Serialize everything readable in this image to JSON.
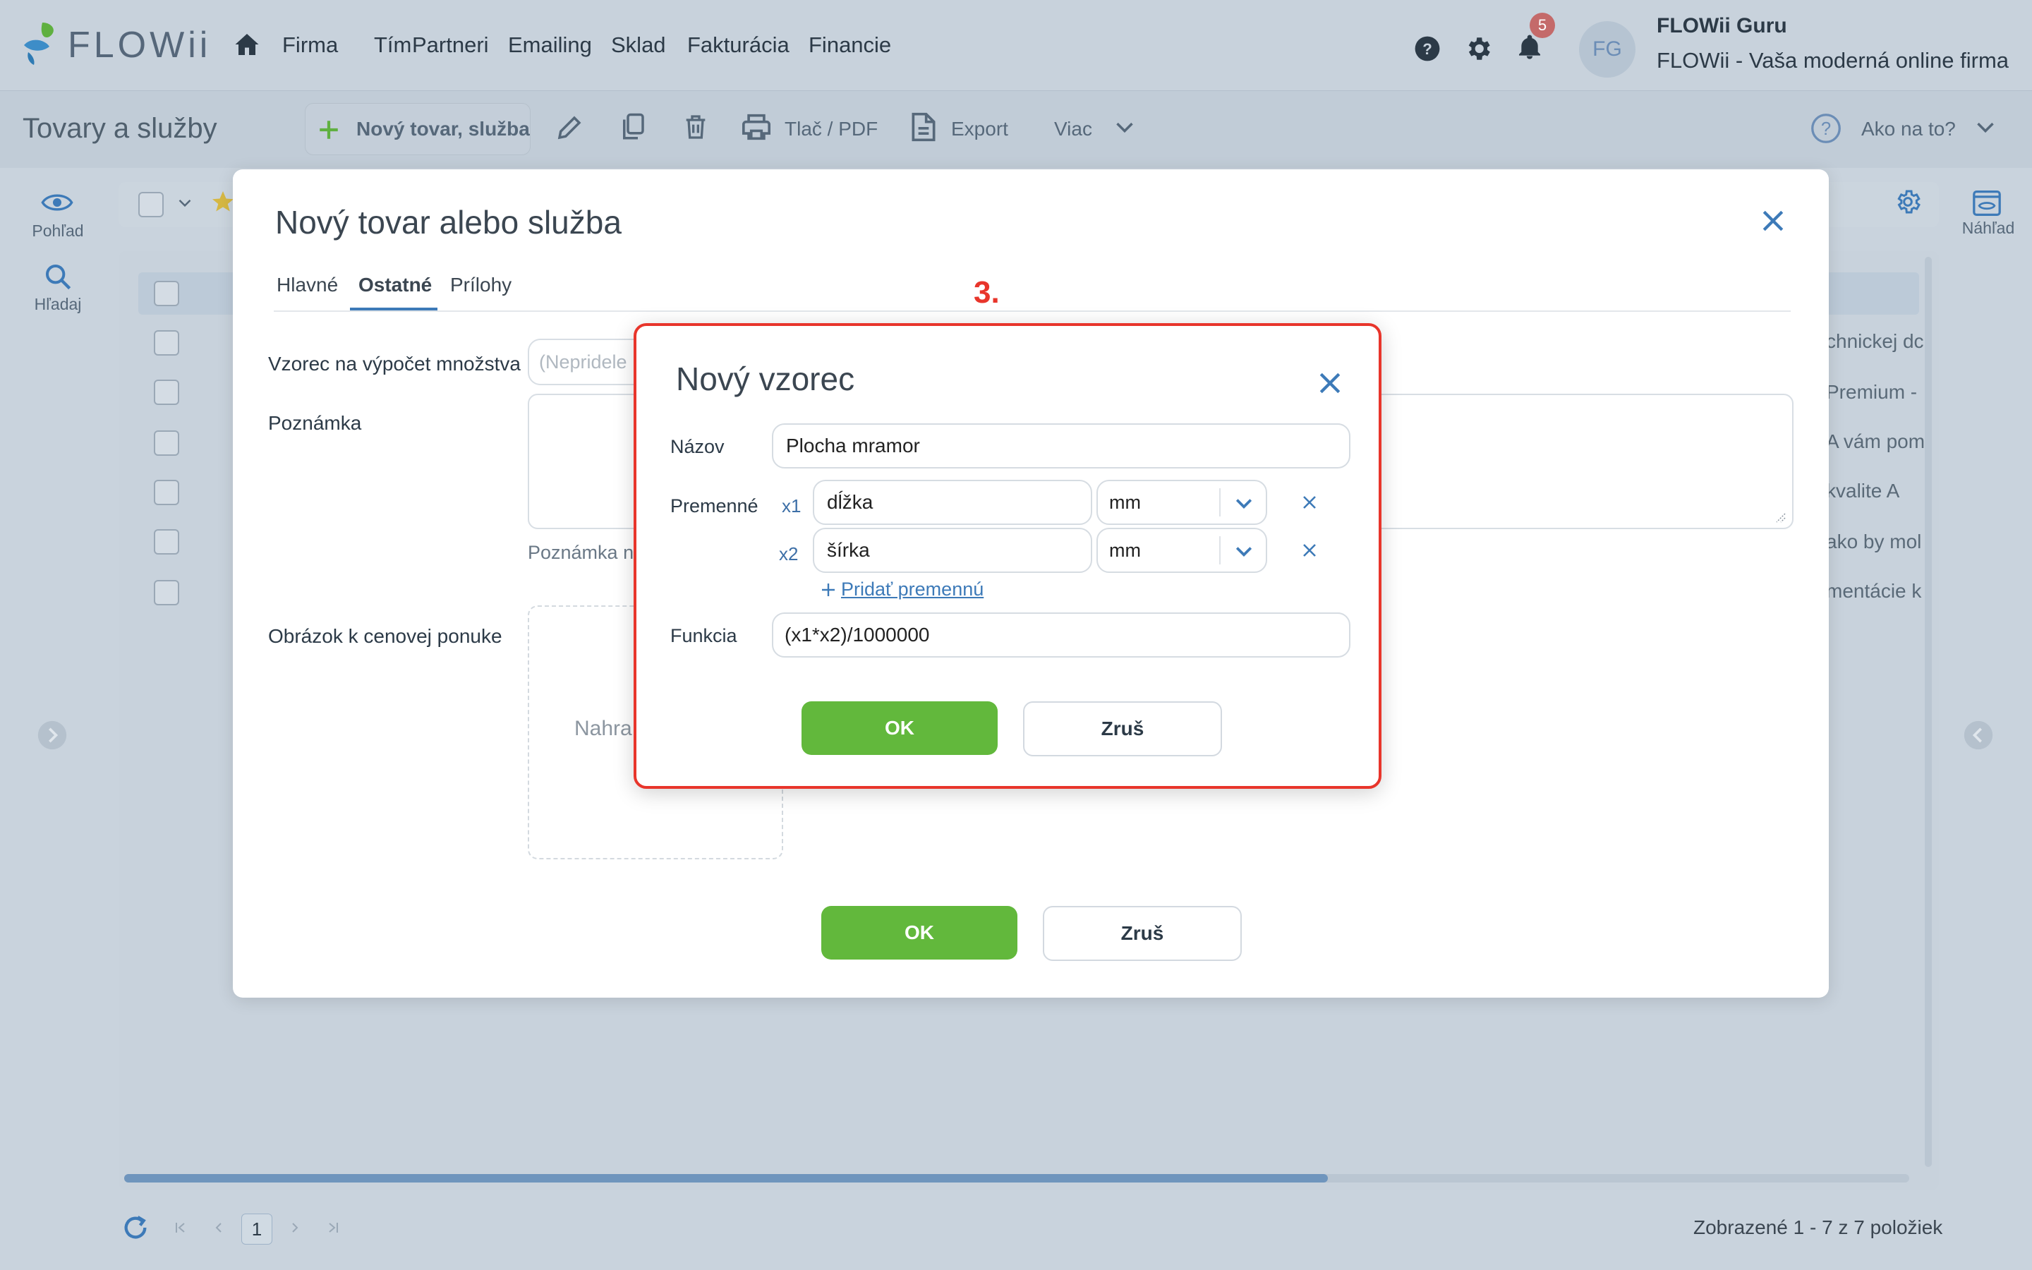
{
  "app": {
    "logo": "FLOWii",
    "nav": [
      "Firma",
      "Tím",
      "Partneri",
      "Emailing",
      "Sklad",
      "Fakturácia",
      "Financie"
    ],
    "notifications_count": "5",
    "user_initials": "FG",
    "user_name": "FLOWii Guru",
    "company": "FLOWii - Vaša moderná online firma"
  },
  "toolbar": {
    "page_title": "Tovary a služby",
    "new_item": "Nový tovar, služba",
    "print": "Tlač / PDF",
    "export": "Export",
    "more": "Viac",
    "help": "Ako na to?"
  },
  "sidebar": {
    "view": "Pohľad",
    "search": "Hľadaj",
    "preview": "Náhľad"
  },
  "background_rows": [
    "chnickej dc",
    "Premium -",
    "A vám pom",
    "kvalite A",
    "ako by mol",
    "mentácie k"
  ],
  "pagination": {
    "page": "1",
    "summary": "Zobrazené 1 - 7 z 7 položiek"
  },
  "modal": {
    "title": "Nový tovar alebo služba",
    "tabs": [
      "Hlavné",
      "Ostatné",
      "Prílohy"
    ],
    "active_tab": "Ostatné",
    "formula_label": "Vzorec na výpočet množstva",
    "formula_placeholder": "(Nepridele",
    "note_label": "Poznámka",
    "note_hint": "Poznámka n",
    "image_label": "Obrázok k cenovej ponuke",
    "upload_text": "Nahra",
    "ok": "OK",
    "cancel": "Zruš"
  },
  "step_marker": "3.",
  "dialog": {
    "title": "Nový vzorec",
    "name_label": "Názov",
    "name_value": "Plocha mramor",
    "vars_label": "Premenné",
    "variables": [
      {
        "index": "x1",
        "name": "dĺžka",
        "unit": "mm"
      },
      {
        "index": "x2",
        "name": "šírka",
        "unit": "mm"
      }
    ],
    "add_variable": "Pridať premennú",
    "function_label": "Funkcia",
    "function_value": "(x1*x2)/1000000",
    "ok": "OK",
    "cancel": "Zruš"
  },
  "colors": {
    "accent_green": "#62b83c",
    "highlight_red": "#e8352b",
    "link_blue": "#3d7ab8"
  }
}
